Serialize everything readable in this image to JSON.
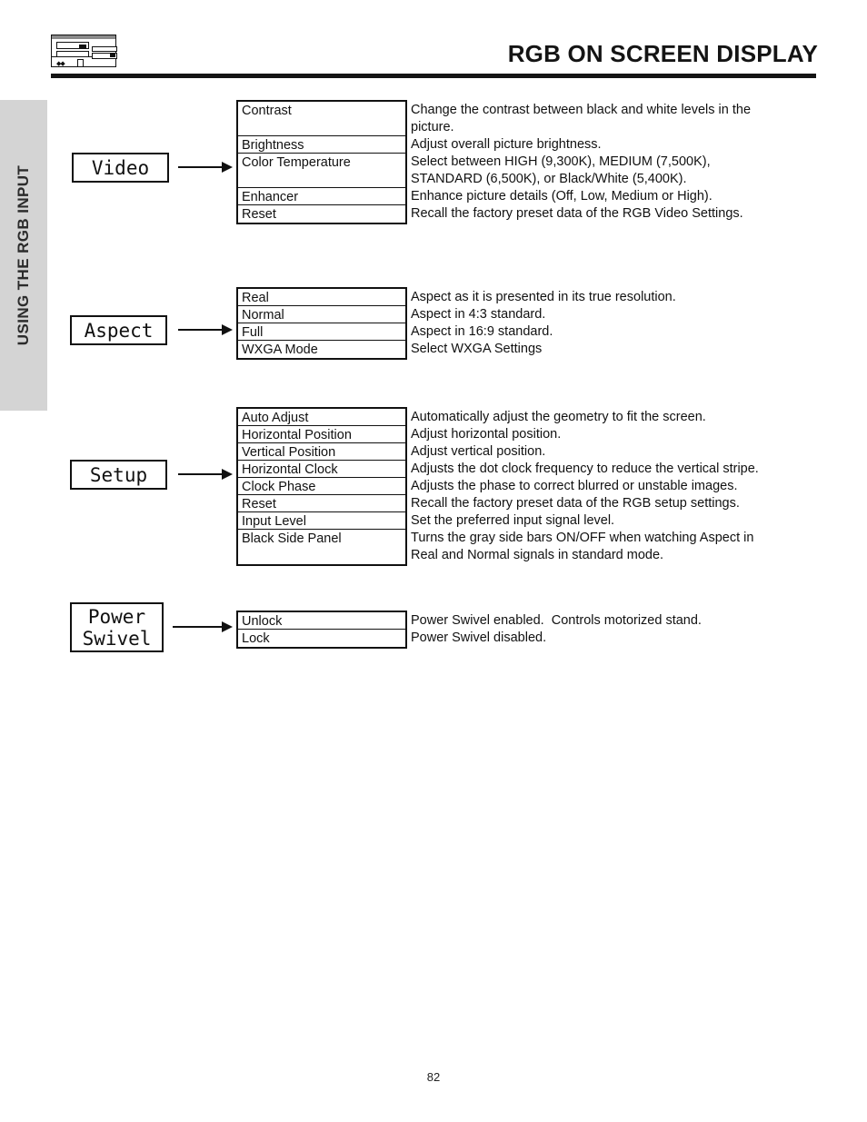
{
  "header": {
    "title": "RGB ON SCREEN DISPLAY",
    "logo_name": "hitachi-product-logo"
  },
  "side_tab": {
    "label": "USING THE RGB INPUT"
  },
  "sections": [
    {
      "id": "video",
      "node_label": "Video",
      "menu_items": [
        "Contrast",
        "Brightness",
        "Color Temperature",
        "Enhancer",
        "Reset"
      ],
      "descriptions": [
        [
          "Change the contrast between black and white levels in the",
          "picture."
        ],
        [
          "Adjust overall picture brightness."
        ],
        [
          "Select between HIGH (9,300K), MEDIUM (7,500K),",
          "STANDARD (6,500K), or Black/White (5,400K)."
        ],
        [
          "Enhance picture details (Off, Low, Medium or High)."
        ],
        [
          "Recall the factory preset data of the RGB Video Settings."
        ]
      ]
    },
    {
      "id": "aspect",
      "node_label": "Aspect",
      "menu_items": [
        "Real",
        "Normal",
        "Full",
        "WXGA Mode"
      ],
      "descriptions": [
        [
          "Aspect as it is presented in its true resolution."
        ],
        [
          "Aspect in 4:3 standard."
        ],
        [
          "Aspect in 16:9 standard."
        ],
        [
          "Select WXGA Settings"
        ]
      ]
    },
    {
      "id": "setup",
      "node_label": "Setup",
      "menu_items": [
        "Auto Adjust",
        "Horizontal Position",
        "Vertical Position",
        "Horizontal Clock",
        "Clock Phase",
        "Reset",
        "Input Level",
        "Black Side Panel"
      ],
      "descriptions": [
        [
          "Automatically adjust the geometry to fit the screen."
        ],
        [
          "Adjust horizontal position."
        ],
        [
          "Adjust vertical position."
        ],
        [
          "Adjusts the dot clock frequency to reduce the vertical stripe."
        ],
        [
          "Adjusts the phase to correct blurred or unstable images."
        ],
        [
          "Recall the factory preset data of the RGB setup settings."
        ],
        [
          "Set the preferred input signal level."
        ],
        [
          "Turns the gray side bars ON/OFF when watching Aspect in",
          "Real and Normal signals in standard mode."
        ]
      ]
    },
    {
      "id": "power-swivel",
      "node_label": "Power\nSwivel",
      "menu_items": [
        "Unlock",
        "Lock"
      ],
      "descriptions": [
        [
          "Power Swivel enabled.  Controls motorized stand."
        ],
        [
          "Power Swivel disabled."
        ]
      ]
    }
  ],
  "footer": {
    "page_number": "82"
  }
}
